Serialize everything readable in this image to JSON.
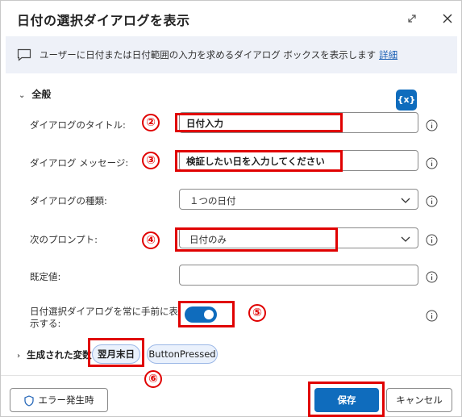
{
  "dialog": {
    "title": "日付の選択ダイアログを表示",
    "info_text": "ユーザーに日付または日付範囲の入力を求めるダイアログ ボックスを表示します",
    "info_link": "詳細"
  },
  "section": {
    "label": "全般",
    "var_button": "{x}"
  },
  "fields": {
    "dialog_title_label": "ダイアログのタイトル:",
    "dialog_title_value": "日付入力",
    "message_label": "ダイアログ メッセージ:",
    "message_value": "検証したい日を入力してください",
    "type_label": "ダイアログの種類:",
    "type_value": "１つの日付",
    "prompt_label": "次のプロンプト:",
    "prompt_value": "日付のみ",
    "default_label": "既定値:",
    "default_value": "",
    "topmost_label": "日付選択ダイアログを常に手前に表示する:",
    "topmost_on": true
  },
  "generated": {
    "label": "生成された変数",
    "vars": [
      "翌月末日",
      "ButtonPressed"
    ]
  },
  "footer": {
    "error_button": "エラー発生時",
    "save_button": "保存",
    "cancel_button": "キャンセル"
  },
  "annotations": [
    "②",
    "③",
    "④",
    "⑤",
    "⑥"
  ],
  "colors": {
    "accent": "#0f6cbd",
    "highlight": "#e00000"
  }
}
